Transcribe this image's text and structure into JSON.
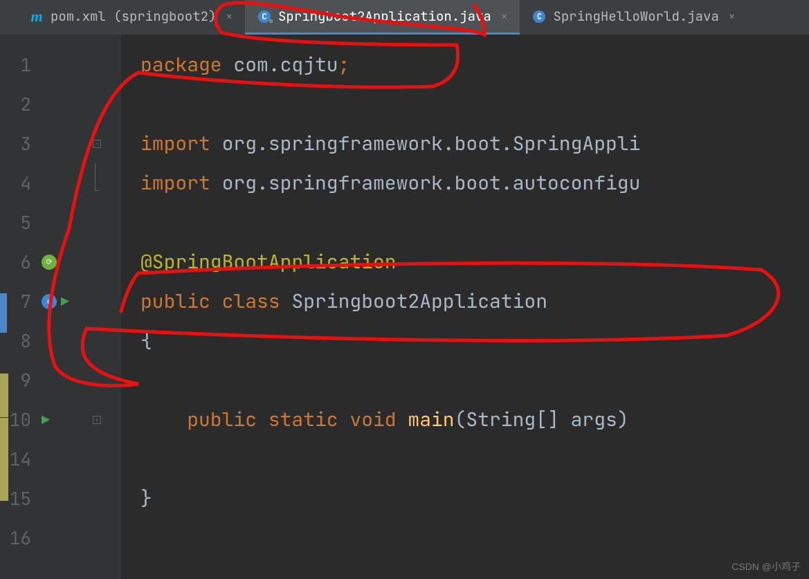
{
  "tabs": [
    {
      "label": "pom.xml (springboot2)",
      "active": false,
      "icon": "maven"
    },
    {
      "label": "Springboot2Application.java",
      "active": true,
      "icon": "java-class-spring"
    },
    {
      "label": "SpringHelloWorld.java",
      "active": false,
      "icon": "java-class"
    }
  ],
  "code": {
    "lines": [
      {
        "num": "1",
        "tokens": [
          [
            "keyword",
            "package "
          ],
          [
            "identifier",
            "com.cqjtu"
          ],
          [
            "semicolon",
            ";"
          ]
        ]
      },
      {
        "num": "2",
        "tokens": []
      },
      {
        "num": "3",
        "fold": "−",
        "tokens": [
          [
            "keyword",
            "import "
          ],
          [
            "identifier",
            "org.springframework.boot.SpringAppli"
          ]
        ]
      },
      {
        "num": "4",
        "fold": "bar",
        "tokens": [
          [
            "keyword",
            "import "
          ],
          [
            "identifier",
            "org.springframework.boot.autoconfigu"
          ]
        ]
      },
      {
        "num": "5",
        "tokens": []
      },
      {
        "num": "6",
        "icons": [
          "spring-search"
        ],
        "tokens": [
          [
            "annotation",
            "@SpringBootApplication"
          ]
        ]
      },
      {
        "num": "7",
        "icons": [
          "spring-web",
          "run"
        ],
        "tokens": [
          [
            "keyword",
            "public class "
          ],
          [
            "identifier",
            "Springboot2Application"
          ]
        ]
      },
      {
        "num": "8",
        "tokens": [
          [
            "brace",
            "{"
          ]
        ]
      },
      {
        "num": "9",
        "tokens": []
      },
      {
        "num": "10",
        "icons": [
          "run"
        ],
        "fold": "+",
        "tokens": [
          [
            "default",
            "    "
          ],
          [
            "keyword",
            "public static void "
          ],
          [
            "method",
            "main"
          ],
          [
            "default",
            "(String[] args)"
          ]
        ]
      },
      {
        "num": "14",
        "tokens": []
      },
      {
        "num": "15",
        "tokens": [
          [
            "brace",
            "}"
          ]
        ]
      },
      {
        "num": "16",
        "tokens": []
      }
    ]
  },
  "watermark": "CSDN @小鸡子"
}
